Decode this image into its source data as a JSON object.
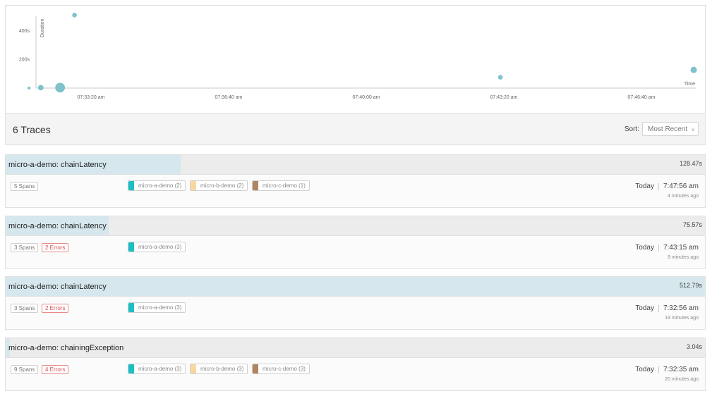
{
  "chart_data": {
    "type": "scatter",
    "title": "",
    "xlabel": "Time",
    "ylabel": "Duration",
    "x_tick_labels": [
      "07:33:20 am",
      "07:36:40 am",
      "07:40:00 am",
      "07:43:20 am",
      "07:46:40 am"
    ],
    "y_tick_labels": [
      "200s",
      "400s"
    ],
    "y_ticks": [
      200,
      400
    ],
    "ylim": [
      0,
      520
    ],
    "grid": false,
    "series": [
      {
        "color": "#7ec2cc",
        "points": [
          {
            "x": "07:31:50 am",
            "y": 0,
            "spans": 1
          },
          {
            "x": "07:32:07 am",
            "y": 3,
            "spans": 4
          },
          {
            "x": "07:32:35 am",
            "y": 3,
            "spans": 9
          },
          {
            "x": "07:32:56 am",
            "y": 513,
            "spans": 3
          },
          {
            "x": "07:43:15 am",
            "y": 76,
            "spans": 3
          },
          {
            "x": "07:47:56 am",
            "y": 128,
            "spans": 5
          }
        ]
      }
    ]
  },
  "traces_header": {
    "count_label": "6 Traces",
    "sort_label": "Sort:",
    "sort_value": "Most Recent"
  },
  "icons": {
    "sort_chevron": "chevron-down-icon"
  },
  "colors": {
    "micro_a_demo": "#1ebfc4",
    "micro_b_demo": "#f7d9a0",
    "micro_c_demo": "#b08560",
    "errors": "#d84a4a",
    "duration_fill": "#d6e8ee"
  },
  "traces": [
    {
      "title": "micro-a-demo: chainLatency",
      "duration": "128.47s",
      "duration_value": 128.47,
      "spans": "5 Spans",
      "errors": "",
      "services": [
        {
          "name": "micro-a-demo (2)",
          "color": "#1ebfc4"
        },
        {
          "name": "micro-b-demo (2)",
          "color": "#f7d9a0"
        },
        {
          "name": "micro-c-demo (1)",
          "color": "#b08560"
        }
      ],
      "date": "Today",
      "time": "7:47:56 am",
      "ago": "4 minutes ago"
    },
    {
      "title": "micro-a-demo: chainLatency",
      "duration": "75.57s",
      "duration_value": 75.57,
      "spans": "3 Spans",
      "errors": "2 Errors",
      "services": [
        {
          "name": "micro-a-demo (3)",
          "color": "#1ebfc4"
        }
      ],
      "date": "Today",
      "time": "7:43:15 am",
      "ago": "9 minutes ago"
    },
    {
      "title": "micro-a-demo: chainLatency",
      "duration": "512.79s",
      "duration_value": 512.79,
      "spans": "3 Spans",
      "errors": "2 Errors",
      "services": [
        {
          "name": "micro-a-demo (3)",
          "color": "#1ebfc4"
        }
      ],
      "date": "Today",
      "time": "7:32:56 am",
      "ago": "19 minutes ago"
    },
    {
      "title": "micro-a-demo: chainingException",
      "duration": "3.04s",
      "duration_value": 3.04,
      "spans": "9 Spans",
      "errors": "4 Errors",
      "services": [
        {
          "name": "micro-a-demo (3)",
          "color": "#1ebfc4"
        },
        {
          "name": "micro-b-demo (3)",
          "color": "#f7d9a0"
        },
        {
          "name": "micro-c-demo (3)",
          "color": "#b08560"
        }
      ],
      "date": "Today",
      "time": "7:32:35 am",
      "ago": "20 minutes ago"
    }
  ]
}
